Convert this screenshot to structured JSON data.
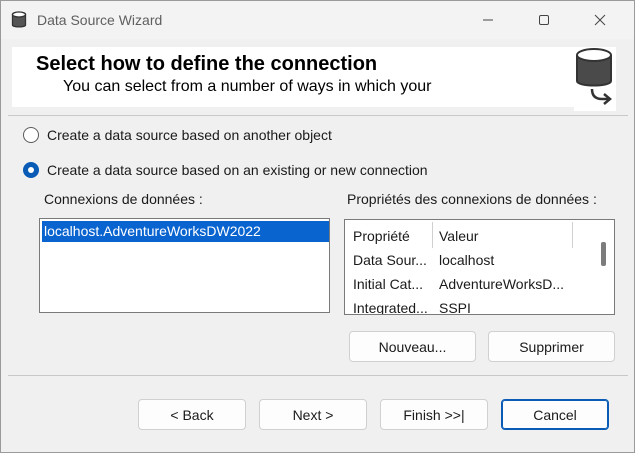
{
  "window": {
    "title": "Data Source Wizard"
  },
  "header": {
    "title": "Select how to define the connection",
    "subtitle": "You can select from a number of ways in which your"
  },
  "options": [
    {
      "label": "Create a data source based on another object",
      "selected": false
    },
    {
      "label": "Create a data source based on an existing or new connection",
      "selected": true
    }
  ],
  "connections": {
    "label": "Connexions de données :",
    "items": [
      "localhost.AdventureWorksDW2022"
    ],
    "selected_index": 0
  },
  "properties": {
    "label": "Propriétés des connexions de données :",
    "columns": [
      "Propriété",
      "Valeur"
    ],
    "rows": [
      {
        "name": "Data Sour...",
        "value": "localhost"
      },
      {
        "name": "Initial Cat...",
        "value": "AdventureWorksD..."
      },
      {
        "name": "Integrated...",
        "value": "SSPI"
      }
    ]
  },
  "buttons": {
    "new": "Nouveau...",
    "delete": "Supprimer",
    "back": "< Back",
    "next": "Next >",
    "finish": "Finish >>|",
    "cancel": "Cancel"
  },
  "colors": {
    "accent": "#0a64d0",
    "background": "#f0f0f0"
  },
  "icons": [
    "database-icon",
    "minimize-icon",
    "maximize-icon",
    "close-icon",
    "database-arrow-icon"
  ]
}
